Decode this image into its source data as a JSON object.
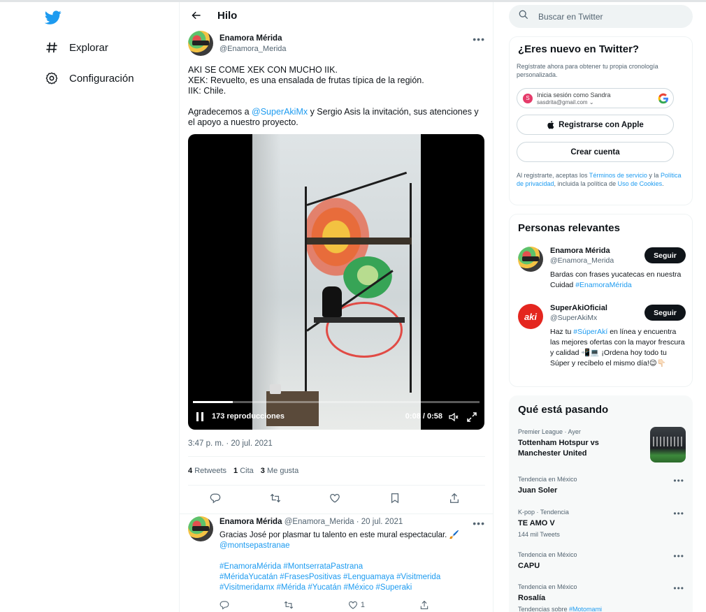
{
  "nav": {
    "explore": "Explorar",
    "settings": "Configuración"
  },
  "header": {
    "title": "Hilo"
  },
  "post": {
    "author_name": "Enamora Mérida",
    "author_handle": "@Enamora_Merida",
    "line1": "AKI SE COME XEK CON MUCHO IIK.",
    "line2": "XEK: Revuelto, es una ensalada de frutas típica de la región.",
    "line3": "IIK: Chile.",
    "thanks_pre": "Agradecemos a ",
    "thanks_mention": "@SuperAkiMx",
    "thanks_post": " y Sergio Asis la invitación, sus atenciones y el apoyo a nuestro proyecto.",
    "video": {
      "views": "173 reproducciones",
      "time": "0:08 / 0:58",
      "progress": 0.138
    },
    "timestamp": "3:47 p. m. · 20 jul. 2021",
    "retweets_count": "4",
    "retweets_label": "Retweets",
    "quotes_count": "1",
    "quotes_label": "Cita",
    "likes_count": "3",
    "likes_label": "Me gusta"
  },
  "reply": {
    "author_name": "Enamora Mérida",
    "meta": "@Enamora_Merida · 20 jul. 2021",
    "text1": "Gracias José por plasmar tu talento en este  mural espectacular. 🖌️",
    "mention": "@montsepastranae",
    "tags1": "#EnamoraMérida #MontserrataPastrana",
    "tags2": "#MéridaYucatán #FrasesPositivas #Lenguamaya #Visitmerida",
    "tags3": "#Visitmeridamx #Mérida #Yucatán #México #Superaki",
    "likes": "1"
  },
  "search": {
    "placeholder": "Buscar en Twitter"
  },
  "signup": {
    "title": "¿Eres nuevo en Twitter?",
    "subtitle": "Regístrate ahora para obtener tu propia cronología personalizada.",
    "google_line1": "Inicia sesión como Sandra",
    "google_line2": "sasdrita@gmail.com",
    "google_avatar": "S",
    "apple": "Registrarse con Apple",
    "create": "Crear cuenta",
    "legal_pre": "Al registrarte, aceptas los ",
    "legal_terms": "Términos de servicio",
    "legal_mid": " y la ",
    "legal_privacy": "Política de privacidad",
    "legal_mid2": ", incluida la política de ",
    "legal_cookies": "Uso de Cookies",
    "legal_end": "."
  },
  "relevant": {
    "title": "Personas relevantes",
    "follow": "Seguir",
    "p1_name": "Enamora Mérida",
    "p1_handle": "@Enamora_Merida",
    "p1_bio_pre": "Bardas con frases yucatecas en nuestra Cuidad ",
    "p1_bio_tag": "#EnamoraMérida",
    "p2_name": "SuperAkiOficial",
    "p2_handle": "@SuperAkiMx",
    "p2_logo": "aki",
    "p2_bio_pre": "Haz tu ",
    "p2_bio_tag": "#SúperAkí",
    "p2_bio_post": " en línea y encuentra las mejores ofertas con la mayor frescura y calidad 📲💻 ¡Ordena hoy todo tu Súper y recíbelo el mismo día!😉👇🏻"
  },
  "trends": {
    "title": "Qué está pasando",
    "t1_ctx": "Premier League · Ayer",
    "t1_title": "Tottenham Hotspur vs Manchester United",
    "t2_ctx": "Tendencia en México",
    "t2_title": "Juan Soler",
    "t3_ctx": "K-pop · Tendencia",
    "t3_title": "TE AMO V",
    "t3_sub": "144 mil Tweets",
    "t4_ctx": "Tendencia en México",
    "t4_title": "CAPU",
    "t5_ctx": "Tendencia en México",
    "t5_title": "Rosalía",
    "t5_sub_pre": "Tendencias sobre ",
    "t5_sub_tag": "#Motomami"
  },
  "colors": {
    "accent": "#1d9bf0",
    "text": "#0f1419",
    "muted": "#536471"
  }
}
